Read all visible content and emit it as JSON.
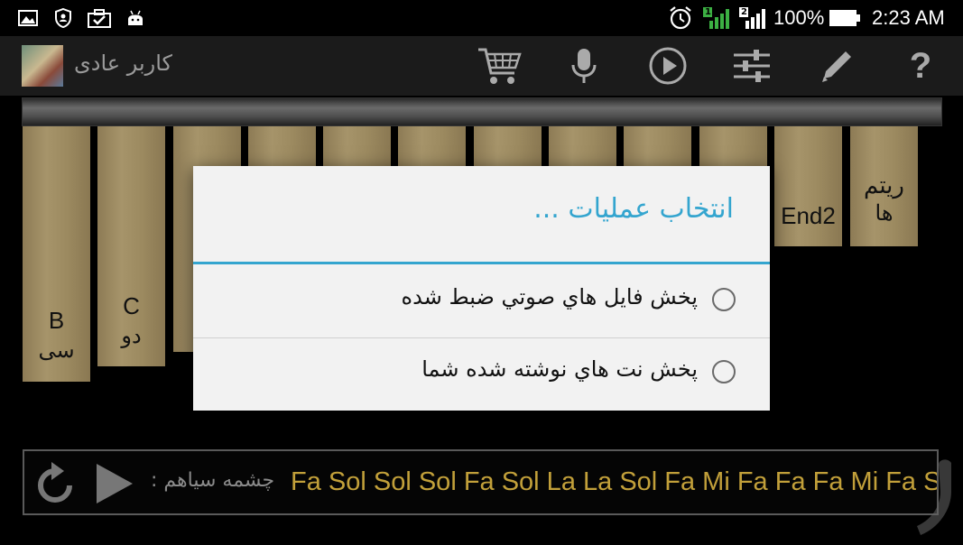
{
  "status_bar": {
    "battery": "100%",
    "time": "2:23 AM",
    "sim1": "1",
    "sim2": "2",
    "left_icons": [
      "image-icon",
      "shield-person-icon",
      "briefcase-check-icon",
      "android-icon"
    ]
  },
  "app_bar": {
    "user_name": "کاربر عادی",
    "actions": [
      "cart-icon",
      "microphone-icon",
      "play-circle-icon",
      "equalizer-icon",
      "pencil-icon",
      "help-icon"
    ]
  },
  "keys": [
    {
      "top": "B",
      "bottom": "سی"
    },
    {
      "top": "C",
      "bottom": "دو"
    },
    {
      "top": "",
      "bottom": ""
    },
    {
      "top": "",
      "bottom": ""
    },
    {
      "top": "",
      "bottom": ""
    },
    {
      "top": "",
      "bottom": ""
    },
    {
      "top": "",
      "bottom": ""
    },
    {
      "top": "",
      "bottom": ""
    },
    {
      "top": "",
      "bottom": ""
    },
    {
      "top": "",
      "bottom": ""
    },
    {
      "top": "End2",
      "bottom": ""
    },
    {
      "top": "ریتم",
      "bottom": "ها"
    }
  ],
  "dialog": {
    "title": "انتخاب عملیات ...",
    "options": [
      {
        "label": "پخش فایل هاي صوتي ضبط شده",
        "selected": false
      },
      {
        "label": "پخش نت هاي نوشته شده شما",
        "selected": false
      }
    ],
    "accent_color": "#34a5cf"
  },
  "player": {
    "song_title": "چشمه سیاهم :",
    "notes": "Fa Sol Sol Sol Fa Sol La La Sol Fa Mi Fa Fa Fa Mi Fa So",
    "notes_color": "#c2a03a"
  }
}
